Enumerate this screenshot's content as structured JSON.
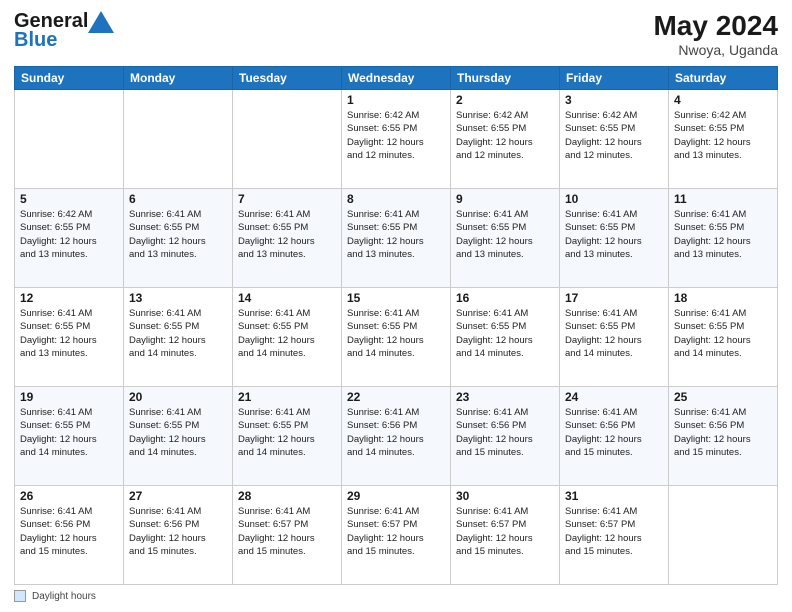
{
  "header": {
    "logo_line1": "General",
    "logo_line2": "Blue",
    "title": "May 2024",
    "subtitle": "Nwoya, Uganda"
  },
  "days_of_week": [
    "Sunday",
    "Monday",
    "Tuesday",
    "Wednesday",
    "Thursday",
    "Friday",
    "Saturday"
  ],
  "weeks": [
    {
      "cells": [
        {
          "day": "",
          "info": ""
        },
        {
          "day": "",
          "info": ""
        },
        {
          "day": "",
          "info": ""
        },
        {
          "day": "1",
          "info": "Sunrise: 6:42 AM\nSunset: 6:55 PM\nDaylight: 12 hours\nand 12 minutes."
        },
        {
          "day": "2",
          "info": "Sunrise: 6:42 AM\nSunset: 6:55 PM\nDaylight: 12 hours\nand 12 minutes."
        },
        {
          "day": "3",
          "info": "Sunrise: 6:42 AM\nSunset: 6:55 PM\nDaylight: 12 hours\nand 12 minutes."
        },
        {
          "day": "4",
          "info": "Sunrise: 6:42 AM\nSunset: 6:55 PM\nDaylight: 12 hours\nand 13 minutes."
        }
      ]
    },
    {
      "cells": [
        {
          "day": "5",
          "info": "Sunrise: 6:42 AM\nSunset: 6:55 PM\nDaylight: 12 hours\nand 13 minutes."
        },
        {
          "day": "6",
          "info": "Sunrise: 6:41 AM\nSunset: 6:55 PM\nDaylight: 12 hours\nand 13 minutes."
        },
        {
          "day": "7",
          "info": "Sunrise: 6:41 AM\nSunset: 6:55 PM\nDaylight: 12 hours\nand 13 minutes."
        },
        {
          "day": "8",
          "info": "Sunrise: 6:41 AM\nSunset: 6:55 PM\nDaylight: 12 hours\nand 13 minutes."
        },
        {
          "day": "9",
          "info": "Sunrise: 6:41 AM\nSunset: 6:55 PM\nDaylight: 12 hours\nand 13 minutes."
        },
        {
          "day": "10",
          "info": "Sunrise: 6:41 AM\nSunset: 6:55 PM\nDaylight: 12 hours\nand 13 minutes."
        },
        {
          "day": "11",
          "info": "Sunrise: 6:41 AM\nSunset: 6:55 PM\nDaylight: 12 hours\nand 13 minutes."
        }
      ]
    },
    {
      "cells": [
        {
          "day": "12",
          "info": "Sunrise: 6:41 AM\nSunset: 6:55 PM\nDaylight: 12 hours\nand 13 minutes."
        },
        {
          "day": "13",
          "info": "Sunrise: 6:41 AM\nSunset: 6:55 PM\nDaylight: 12 hours\nand 14 minutes."
        },
        {
          "day": "14",
          "info": "Sunrise: 6:41 AM\nSunset: 6:55 PM\nDaylight: 12 hours\nand 14 minutes."
        },
        {
          "day": "15",
          "info": "Sunrise: 6:41 AM\nSunset: 6:55 PM\nDaylight: 12 hours\nand 14 minutes."
        },
        {
          "day": "16",
          "info": "Sunrise: 6:41 AM\nSunset: 6:55 PM\nDaylight: 12 hours\nand 14 minutes."
        },
        {
          "day": "17",
          "info": "Sunrise: 6:41 AM\nSunset: 6:55 PM\nDaylight: 12 hours\nand 14 minutes."
        },
        {
          "day": "18",
          "info": "Sunrise: 6:41 AM\nSunset: 6:55 PM\nDaylight: 12 hours\nand 14 minutes."
        }
      ]
    },
    {
      "cells": [
        {
          "day": "19",
          "info": "Sunrise: 6:41 AM\nSunset: 6:55 PM\nDaylight: 12 hours\nand 14 minutes."
        },
        {
          "day": "20",
          "info": "Sunrise: 6:41 AM\nSunset: 6:55 PM\nDaylight: 12 hours\nand 14 minutes."
        },
        {
          "day": "21",
          "info": "Sunrise: 6:41 AM\nSunset: 6:55 PM\nDaylight: 12 hours\nand 14 minutes."
        },
        {
          "day": "22",
          "info": "Sunrise: 6:41 AM\nSunset: 6:56 PM\nDaylight: 12 hours\nand 14 minutes."
        },
        {
          "day": "23",
          "info": "Sunrise: 6:41 AM\nSunset: 6:56 PM\nDaylight: 12 hours\nand 15 minutes."
        },
        {
          "day": "24",
          "info": "Sunrise: 6:41 AM\nSunset: 6:56 PM\nDaylight: 12 hours\nand 15 minutes."
        },
        {
          "day": "25",
          "info": "Sunrise: 6:41 AM\nSunset: 6:56 PM\nDaylight: 12 hours\nand 15 minutes."
        }
      ]
    },
    {
      "cells": [
        {
          "day": "26",
          "info": "Sunrise: 6:41 AM\nSunset: 6:56 PM\nDaylight: 12 hours\nand 15 minutes."
        },
        {
          "day": "27",
          "info": "Sunrise: 6:41 AM\nSunset: 6:56 PM\nDaylight: 12 hours\nand 15 minutes."
        },
        {
          "day": "28",
          "info": "Sunrise: 6:41 AM\nSunset: 6:57 PM\nDaylight: 12 hours\nand 15 minutes."
        },
        {
          "day": "29",
          "info": "Sunrise: 6:41 AM\nSunset: 6:57 PM\nDaylight: 12 hours\nand 15 minutes."
        },
        {
          "day": "30",
          "info": "Sunrise: 6:41 AM\nSunset: 6:57 PM\nDaylight: 12 hours\nand 15 minutes."
        },
        {
          "day": "31",
          "info": "Sunrise: 6:41 AM\nSunset: 6:57 PM\nDaylight: 12 hours\nand 15 minutes."
        },
        {
          "day": "",
          "info": ""
        }
      ]
    }
  ],
  "footer": {
    "box_label": "Daylight hours"
  }
}
